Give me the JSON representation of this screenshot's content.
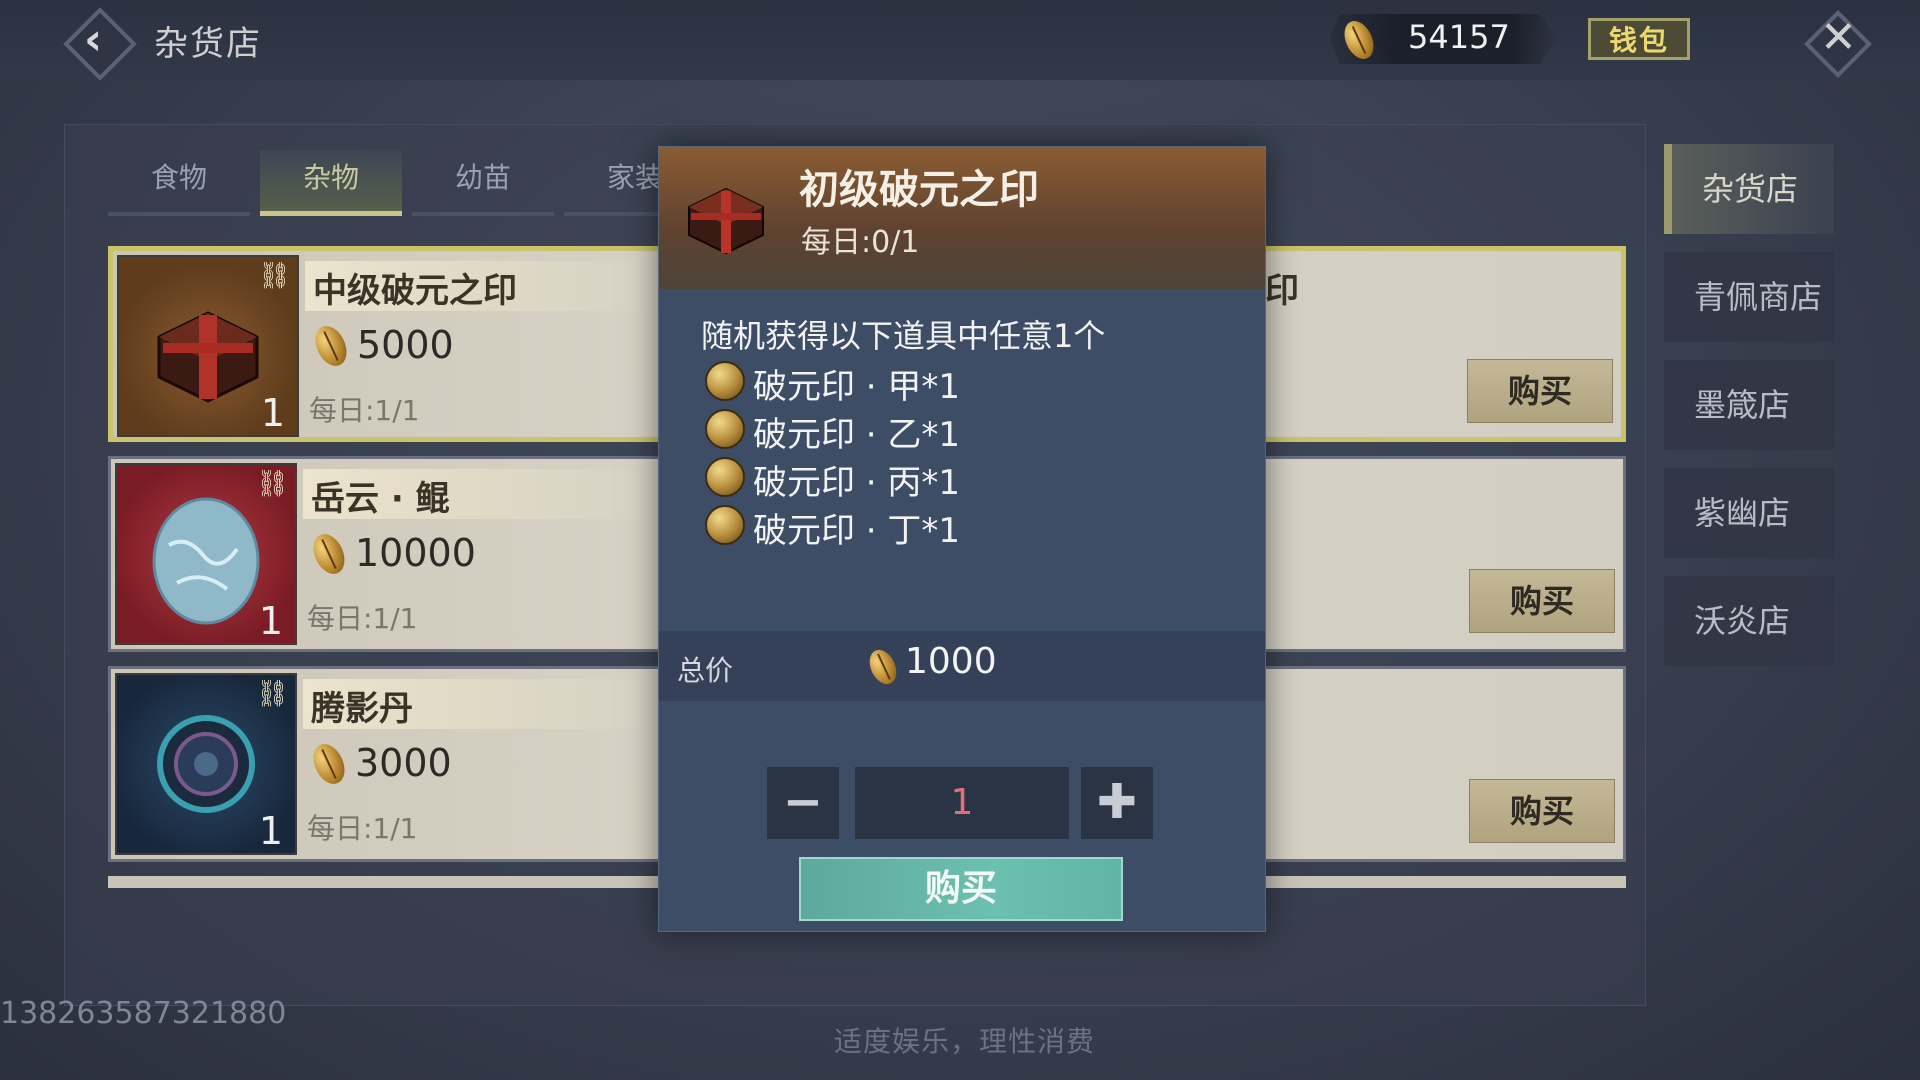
{
  "header": {
    "title": "杂货店",
    "currency_amount": "54157",
    "wallet_label": "钱包"
  },
  "tabs": [
    {
      "label": "食物"
    },
    {
      "label": "杂物"
    },
    {
      "label": "幼苗"
    },
    {
      "label": "家装"
    }
  ],
  "active_tab": "杂物",
  "items": [
    {
      "name": "中级破元之印",
      "price": "5000",
      "limit": "每日:1/1",
      "count": "1",
      "buy_label": "购买",
      "partial_name": "印"
    },
    {
      "name": "岳云 · 鲲",
      "price": "10000",
      "limit": "每日:1/1",
      "count": "1",
      "buy_label": "购买"
    },
    {
      "name": "腾影丹",
      "price": "3000",
      "limit": "每日:1/1",
      "count": "1",
      "buy_label": "购买"
    }
  ],
  "shops": [
    {
      "label": "杂货店"
    },
    {
      "label": "青佩商店"
    },
    {
      "label": "墨箴店"
    },
    {
      "label": "紫幽店"
    },
    {
      "label": "沃炎店"
    }
  ],
  "modal": {
    "title": "初级破元之印",
    "limit": "每日:0/1",
    "description": "随机获得以下道具中任意1个",
    "rewards": [
      {
        "text": "破元印 · 甲*1"
      },
      {
        "text": "破元印 · 乙*1"
      },
      {
        "text": "破元印 · 丙*1"
      },
      {
        "text": "破元印 · 丁*1"
      }
    ],
    "total_label": "总价",
    "total_value": "1000",
    "quantity": "1",
    "minus_label": "−",
    "plus_label": "✚",
    "buy_label": "购买"
  },
  "footer": {
    "uid": "138263587321880",
    "notice": "适度娱乐，理性消费"
  },
  "colors": {
    "accent_gold": "#c9c46a",
    "buy_teal": "#6cc0b0",
    "qty_red": "#e0707a"
  }
}
